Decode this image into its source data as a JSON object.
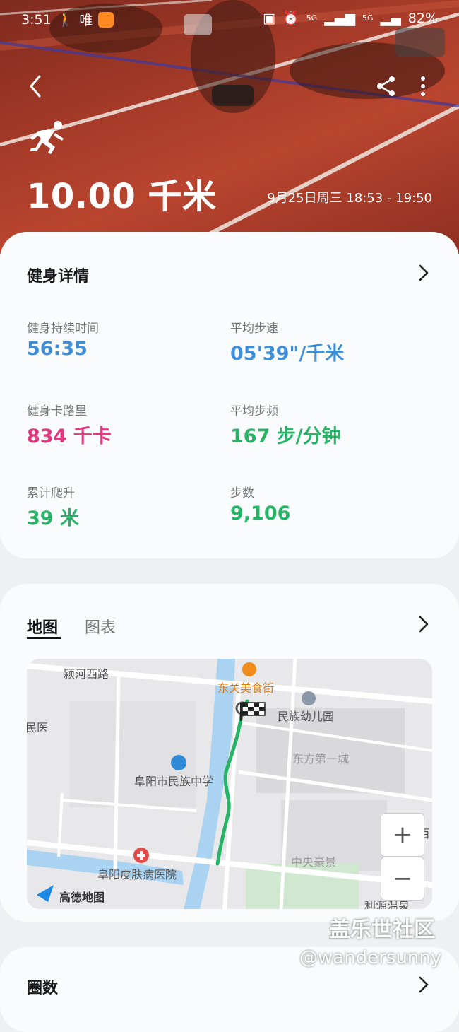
{
  "status_bar": {
    "time": "3:51",
    "app_text": "唯",
    "network_1": "5G",
    "network_2": "5G",
    "battery": "82%"
  },
  "header": {
    "distance": "10.00 千米",
    "datetime": "9月25日周三 18:53 - 19:50",
    "icons": [
      "back-icon",
      "share-icon",
      "more-icon",
      "running-icon"
    ]
  },
  "details": {
    "title": "健身详情",
    "metrics": [
      {
        "label": "健身持续时间",
        "value": "56:35",
        "color": "#3f8fd8"
      },
      {
        "label": "平均步速",
        "value": "05'39\"/千米",
        "color": "#3f8fd8"
      },
      {
        "label": "健身卡路里",
        "value": "834 千卡",
        "color": "#e4377f"
      },
      {
        "label": "平均步频",
        "value": "167 步/分钟",
        "color": "#27b466"
      },
      {
        "label": "累计爬升",
        "value": "39 米",
        "color": "#27b466"
      },
      {
        "label": "步数",
        "value": "9,106",
        "color": "#27b466"
      }
    ]
  },
  "map_section": {
    "tabs": [
      {
        "label": "地图",
        "active": true
      },
      {
        "label": "图表",
        "active": false
      }
    ],
    "map_labels": {
      "road": "颍河西路",
      "food": "东关美食街",
      "kindergarten": "民族幼儿园",
      "left_edge": "民医",
      "community": "东方第一城",
      "school": "阜阳市民族中学",
      "hospital": "阜阳皮肤病医院",
      "area": "中央豪景",
      "bottom_right": "利源温泉",
      "right_edge": "百",
      "logo": "高德地图"
    },
    "zoom_in": "+",
    "zoom_out": "−",
    "route_color": "#27b466"
  },
  "third_section": {
    "title": "圈数"
  },
  "watermark": {
    "site": "盖乐世社区",
    "user": "@wandersunny"
  }
}
